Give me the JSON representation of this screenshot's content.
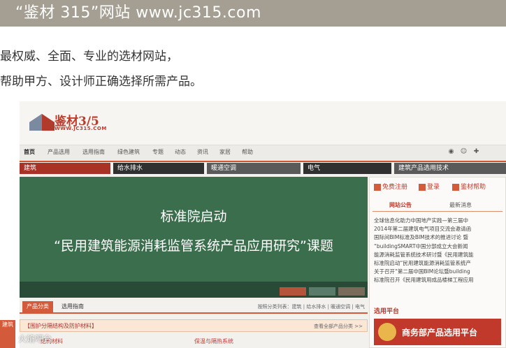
{
  "header": {
    "title": "“鉴材 315”网站 www.jc315.com"
  },
  "slogan": {
    "line1": "最权威、全面、专业的选材网站，",
    "line2": "帮助甲方、设计师正确选择所需产品。"
  },
  "site": {
    "logo_text": "鉴材3/5",
    "logo_url": "WWW.JC315.COM",
    "nav": [
      "首页",
      "产品选用",
      "选用指南",
      "绿色建筑",
      "专题",
      "动态",
      "资讯",
      "家居",
      "帮助"
    ],
    "categories": [
      "建筑",
      "给水排水",
      "暖通空调",
      "电气",
      "建筑产品选用技术"
    ],
    "banner": {
      "line1": "标准院启动",
      "line2": "“民用建筑能源消耗监管系统产品应用研究”课题"
    },
    "actions": {
      "register": "免费注册",
      "login": "登录",
      "help": "鉴材帮助"
    },
    "right_tabs": [
      "网站公告",
      "最新消息"
    ],
    "news": [
      "全球信息化助力中国地产实践—第三届中",
      "2014年第二届建筑电气项目交流会邀请函",
      "国际间BIM标准及BIM技术的推进讨论 暨",
      "“buildingSMART中国分部成立大会新闻",
      "能源消耗监管系统技术研讨暨《民用建筑能",
      "标准院启动“民用建筑能源消耗监管系统产",
      "关于召开“第二届中国BIM论坛暨building",
      "标准院召开《民用建筑用成品楼梯工程应用"
    ],
    "platform_label": "选用平台",
    "platform_banner": "商务部产品选用平台",
    "product_tabs": [
      "产品分类",
      "选用指南"
    ],
    "product_links": "按照分类列表：建筑 | 给水排水 | 暖通空调 | 电气",
    "panel_title": "【围护分隔结构及防护材料】",
    "panel_more": "查看全部产品分类 >>",
    "panel_row_left": "结构材料",
    "panel_row_mid": "保温与隔热系统",
    "side_tab": "建筑",
    "watermark": "火焰吧台"
  },
  "colors": {
    "accent": "#d35a3a",
    "banner": "#3b6e4d",
    "header": "#a49f92"
  }
}
